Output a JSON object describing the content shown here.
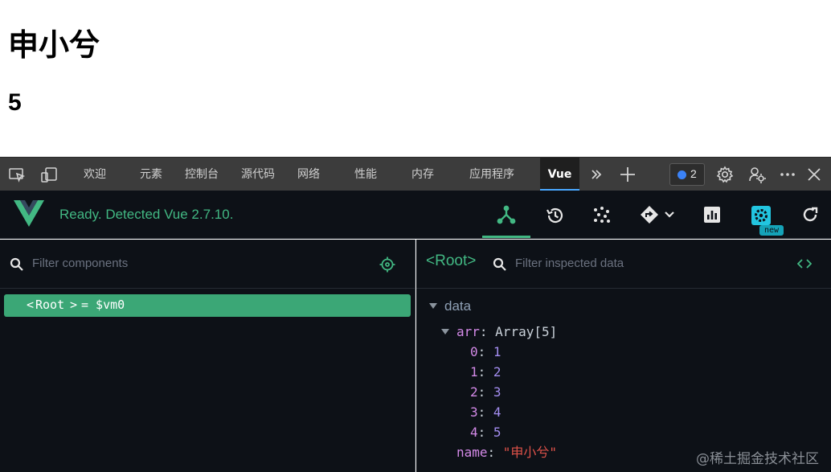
{
  "page": {
    "title": "申小兮",
    "count": "5"
  },
  "devtools_tabs": {
    "items": [
      "欢迎",
      "元素",
      "控制台",
      "源代码",
      "网络",
      "性能",
      "内存",
      "应用程序",
      "Vue"
    ],
    "active": "Vue",
    "issues_count": "2"
  },
  "vue_header": {
    "status": "Ready. Detected Vue 2.7.10.",
    "new_badge": "new"
  },
  "components_panel": {
    "filter_placeholder": "Filter components",
    "root_name": "Root",
    "root_suffix": "= $vm0"
  },
  "inspector_panel": {
    "selected": "Root",
    "filter_placeholder": "Filter inspected data",
    "section": "data",
    "arr_key": "arr",
    "arr_type": "Array[5]",
    "arr_items": [
      {
        "index": "0",
        "value": "1"
      },
      {
        "index": "1",
        "value": "2"
      },
      {
        "index": "2",
        "value": "3"
      },
      {
        "index": "3",
        "value": "4"
      },
      {
        "index": "4",
        "value": "5"
      }
    ],
    "name_key": "name",
    "name_value": "\"申小兮\""
  },
  "watermark": "@稀土掘金技术社区",
  "colors": {
    "vue_green": "#42b883",
    "selection": "#3ba776",
    "key": "#d48ae8",
    "number": "#a38df0",
    "string": "#e0524a",
    "accent_blue": "#4aa8ff"
  }
}
